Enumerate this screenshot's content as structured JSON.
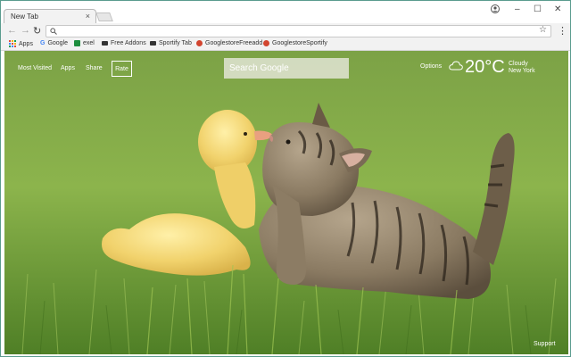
{
  "browser": {
    "tab_title": "New Tab",
    "tab_close": "×",
    "window_controls": {
      "minimize": "–",
      "maximize": "☐",
      "close": "✕"
    },
    "omnibox_value": "",
    "icons": {
      "back": "arrow-left-icon",
      "forward": "arrow-right-icon",
      "reload": "reload-icon",
      "star": "star-icon",
      "menu": "kebab-menu-icon",
      "profile": "profile-icon"
    }
  },
  "bookmarks": [
    {
      "label": "Apps",
      "icon": "apps-grid-icon",
      "color": "#e04a3a"
    },
    {
      "label": "Google",
      "icon": "google-g-icon",
      "color": "#4285f4"
    },
    {
      "label": "exel",
      "icon": "sheets-icon",
      "color": "#1e8e3e"
    },
    {
      "label": "Free Addons",
      "icon": "addons-icon",
      "color": "#333333"
    },
    {
      "label": "Sportify Tab",
      "icon": "tab-icon",
      "color": "#333333"
    },
    {
      "label": "GooglestoreFreeadd",
      "icon": "store-icon",
      "color": "#d2452f"
    },
    {
      "label": "GooglestoreSportify",
      "icon": "store-icon",
      "color": "#d2452f"
    }
  ],
  "newtab": {
    "nav": {
      "most_visited": "Most Visited",
      "apps": "Apps",
      "share": "Share",
      "rate": "Rate"
    },
    "search_placeholder": "Search Google",
    "options": "Options",
    "weather": {
      "temperature": "20°C",
      "condition": "Cloudy",
      "location": "New York",
      "icon": "cloud-icon"
    },
    "support": "Support"
  }
}
